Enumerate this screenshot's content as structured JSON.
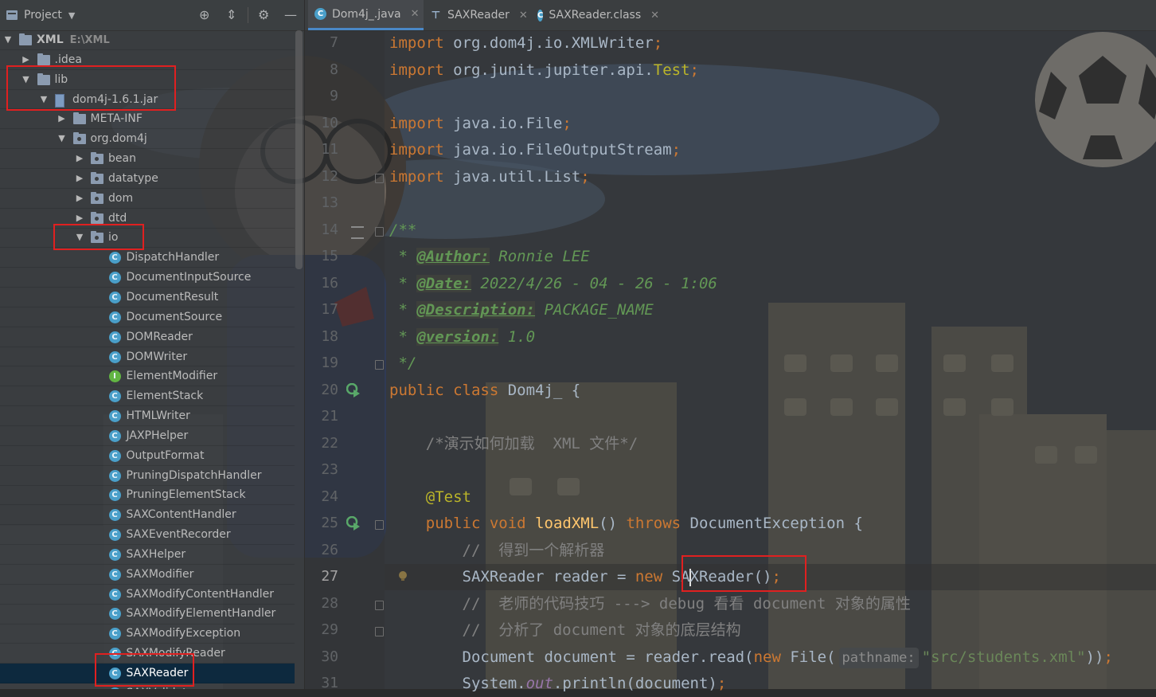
{
  "project_panel": {
    "title": "Project",
    "header_buttons": [
      "crosshair-icon",
      "collapse-icon",
      "gear-icon",
      "minimize-icon"
    ],
    "tree": [
      {
        "label": "XML",
        "detail": "E:\\XML",
        "type": "module",
        "expanded": true,
        "depth": 0
      },
      {
        "label": ".idea",
        "type": "folder",
        "expanded": false,
        "depth": 1
      },
      {
        "label": "lib",
        "type": "folder",
        "expanded": true,
        "depth": 1
      },
      {
        "label": "dom4j-1.6.1.jar",
        "type": "jar",
        "expanded": true,
        "depth": 2
      },
      {
        "label": "META-INF",
        "type": "folder",
        "expanded": false,
        "depth": 3
      },
      {
        "label": "org.dom4j",
        "type": "package",
        "expanded": true,
        "depth": 3
      },
      {
        "label": "bean",
        "type": "package",
        "expanded": false,
        "depth": 4
      },
      {
        "label": "datatype",
        "type": "package",
        "expanded": false,
        "depth": 4
      },
      {
        "label": "dom",
        "type": "package",
        "expanded": false,
        "depth": 4
      },
      {
        "label": "dtd",
        "type": "package",
        "expanded": false,
        "depth": 4
      },
      {
        "label": "io",
        "type": "package",
        "expanded": true,
        "depth": 4
      },
      {
        "label": "DispatchHandler",
        "type": "class",
        "depth": 5
      },
      {
        "label": "DocumentInputSource",
        "type": "class",
        "depth": 5
      },
      {
        "label": "DocumentResult",
        "type": "class",
        "depth": 5
      },
      {
        "label": "DocumentSource",
        "type": "class",
        "depth": 5
      },
      {
        "label": "DOMReader",
        "type": "class",
        "depth": 5
      },
      {
        "label": "DOMWriter",
        "type": "class",
        "depth": 5
      },
      {
        "label": "ElementModifier",
        "type": "interface",
        "depth": 5
      },
      {
        "label": "ElementStack",
        "type": "class",
        "depth": 5
      },
      {
        "label": "HTMLWriter",
        "type": "class",
        "depth": 5
      },
      {
        "label": "JAXPHelper",
        "type": "class",
        "depth": 5
      },
      {
        "label": "OutputFormat",
        "type": "class",
        "depth": 5
      },
      {
        "label": "PruningDispatchHandler",
        "type": "class",
        "depth": 5
      },
      {
        "label": "PruningElementStack",
        "type": "class",
        "depth": 5
      },
      {
        "label": "SAXContentHandler",
        "type": "class",
        "depth": 5
      },
      {
        "label": "SAXEventRecorder",
        "type": "class",
        "depth": 5
      },
      {
        "label": "SAXHelper",
        "type": "class",
        "depth": 5
      },
      {
        "label": "SAXModifier",
        "type": "class",
        "depth": 5
      },
      {
        "label": "SAXModifyContentHandler",
        "type": "class",
        "depth": 5
      },
      {
        "label": "SAXModifyElementHandler",
        "type": "class",
        "depth": 5
      },
      {
        "label": "SAXModifyException",
        "type": "class",
        "depth": 5
      },
      {
        "label": "SAXModifyReader",
        "type": "class",
        "depth": 5
      },
      {
        "label": "SAXReader",
        "type": "class",
        "depth": 5,
        "selected": true
      },
      {
        "label": "SAXValidator",
        "type": "class",
        "depth": 5
      }
    ]
  },
  "editor": {
    "tabs": [
      {
        "label": "Dom4j_.java",
        "icon": "class-icon",
        "active": true
      },
      {
        "label": "SAXReader",
        "icon": "test-icon",
        "active": false
      },
      {
        "label": "SAXReader.class",
        "icon": "class-icon",
        "active": false
      }
    ],
    "current_line": 27,
    "lines": [
      {
        "n": 7,
        "html": "<span class=\"kw\">import</span> org.dom4j.io.XMLWriter<span class=\"kw\">;</span>"
      },
      {
        "n": 8,
        "html": "<span class=\"kw\">import</span> org.junit.jupiter.api.<span class=\"ann\">Test</span><span class=\"kw\">;</span>"
      },
      {
        "n": 9,
        "html": ""
      },
      {
        "n": 10,
        "html": "<span class=\"kw\">import</span> java.io.File<span class=\"kw\">;</span>"
      },
      {
        "n": 11,
        "html": "<span class=\"kw\">import</span> java.io.FileOutputStream<span class=\"kw\">;</span>"
      },
      {
        "n": 12,
        "html": "<span class=\"kw\">import</span> java.util.List<span class=\"kw\">;</span>"
      },
      {
        "n": 13,
        "html": ""
      },
      {
        "n": 14,
        "html": "<span class=\"doc\">/**</span>"
      },
      {
        "n": 15,
        "html": "<span class=\"doc\"> * </span><span class=\"doctag\">@Author:</span><span class=\"doc\"> Ronnie LEE</span>"
      },
      {
        "n": 16,
        "html": "<span class=\"doc\"> * </span><span class=\"doctag\">@Date:</span><span class=\"doc\"> 2022/4/26 - 04 - 26 - 1:06</span>"
      },
      {
        "n": 17,
        "html": "<span class=\"doc\"> * </span><span class=\"doctag\">@Description:</span><span class=\"doc\"> PACKAGE_NAME</span>"
      },
      {
        "n": 18,
        "html": "<span class=\"doc\"> * </span><span class=\"doctag\">@version:</span><span class=\"doc\"> 1.0</span>"
      },
      {
        "n": 19,
        "html": "<span class=\"doc\"> */</span>"
      },
      {
        "n": 20,
        "html": "<span class=\"kw\">public class</span> Dom4j_ {"
      },
      {
        "n": 21,
        "html": ""
      },
      {
        "n": 22,
        "html": "    <span class=\"cm\">/*演示如何加载  XML 文件*/</span>"
      },
      {
        "n": 23,
        "html": ""
      },
      {
        "n": 24,
        "html": "    <span class=\"ann\">@Test</span>"
      },
      {
        "n": 25,
        "html": "    <span class=\"kw\">public void</span> <span class=\"fn\">loadXML</span>() <span class=\"kw\">throws</span> DocumentException {"
      },
      {
        "n": 26,
        "html": "        <span class=\"cm\">//  得到一个解析器</span>"
      },
      {
        "n": 27,
        "html": "        SAXReader reader = <span class=\"kw\">new</span> SA<span class=\"caret\"></span>XReader()<span class=\"kw\">;</span>"
      },
      {
        "n": 28,
        "html": "        <span class=\"cm\">//  老师的代码技巧 ---> debug 看看 document 对象的属性</span>"
      },
      {
        "n": 29,
        "html": "        <span class=\"cm\">//  分析了 document 对象的底层结构</span>"
      },
      {
        "n": 30,
        "html": "        Document document = reader.read(<span class=\"kw\">new</span> File(<span class=\"hint\">pathname:</span><span class=\"str\">\"src/students.xml\"</span>))<span class=\"kw\">;</span>"
      },
      {
        "n": 31,
        "html": "        System.<span class=\"static\">out</span>.println(document)<span class=\"kw\">;</span>"
      }
    ]
  },
  "colors": {
    "accent": "#4a88c7",
    "highlight_box": "#e02020",
    "keyword": "#cc7832",
    "annotation": "#bbb529",
    "doc_comment": "#629755"
  }
}
